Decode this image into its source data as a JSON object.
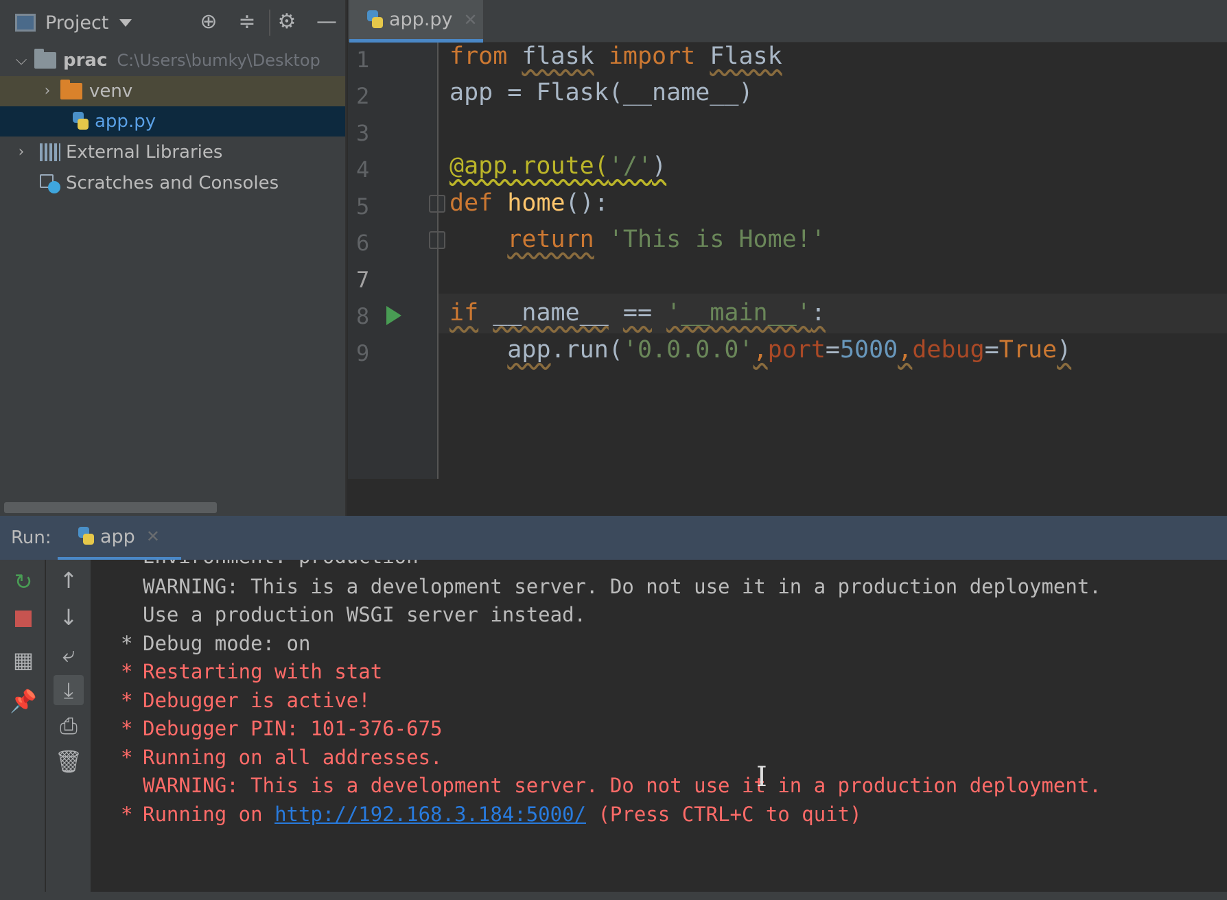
{
  "project_panel": {
    "title": "Project",
    "tree": {
      "root_name": "prac",
      "root_path": "C:\\Users\\bumky\\Desktop",
      "venv": "venv",
      "file": "app.py",
      "external_libraries": "External Libraries",
      "scratches": "Scratches and Consoles"
    }
  },
  "editor": {
    "tab_label": "app.py",
    "line_numbers": [
      "1",
      "2",
      "3",
      "4",
      "5",
      "6",
      "7",
      "8",
      "9"
    ],
    "code": {
      "l1": [
        "from",
        "flask",
        "import",
        "Flask"
      ],
      "l2": "app = Flask(__name__)",
      "l4": [
        "@app.route(",
        "'/'",
        ")"
      ],
      "l5": [
        "def",
        "home",
        "():"
      ],
      "l6": [
        "return",
        "'This is Home!'"
      ],
      "l8": [
        "if",
        "__name__",
        "==",
        "'__main__'",
        ":"
      ],
      "l9": [
        "app",
        ".run(",
        "'0.0.0.0'",
        ",",
        "port",
        "=",
        "5000",
        ",",
        "debug",
        "=",
        "True",
        ")"
      ]
    }
  },
  "run_panel": {
    "label": "Run:",
    "tab_label": "app",
    "console": {
      "partial": "Environment: production",
      "lines": [
        "WARNING: This is a development server. Do not use it in a production deployment.",
        "Use a production WSGI server instead.",
        "Debug mode: on",
        "Restarting with stat",
        "Debugger is active!",
        "Debugger PIN: 101-376-675",
        "Running on all addresses.",
        "WARNING: This is a development server. Do not use it in a production deployment.",
        "Running on "
      ],
      "link": "http://192.168.3.184:5000/",
      "link_suffix": " (Press CTRL+C to quit)",
      "star": "*"
    }
  },
  "colors": {
    "keyword": "#cc7832",
    "string": "#6a8759",
    "number": "#6897bb",
    "function": "#ffc66d",
    "console_error": "#ff6b68",
    "link": "#287bde",
    "selection": "#0d293e"
  }
}
